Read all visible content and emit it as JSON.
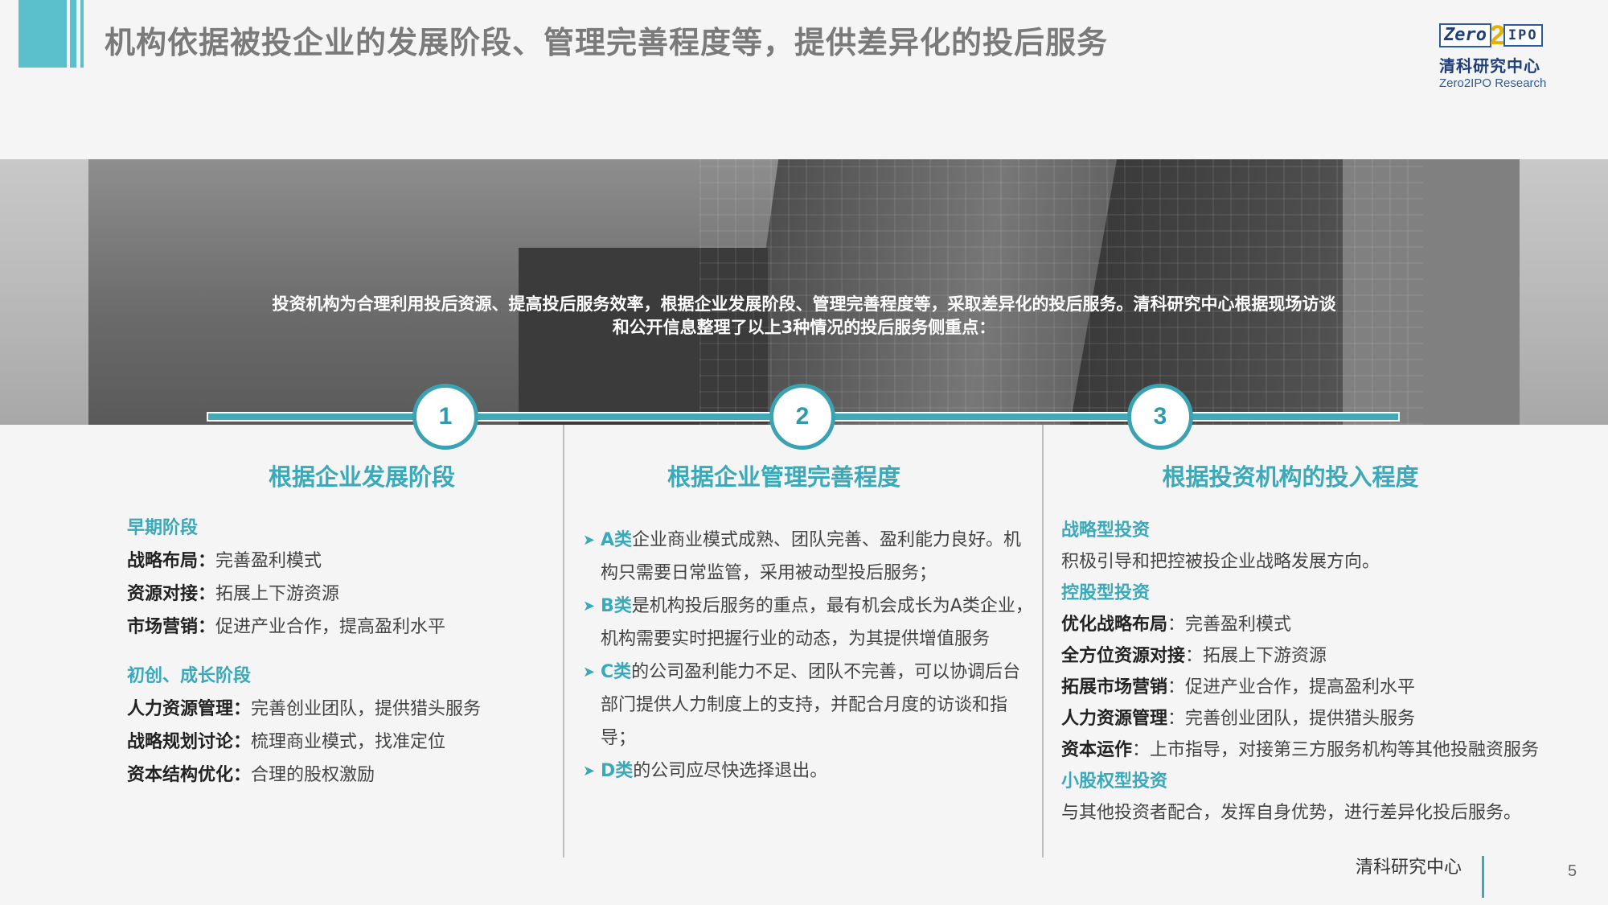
{
  "header": {
    "title": "机构依据被投企业的发展阶段、管理完善程度等，提供差异化的投后服务"
  },
  "logo": {
    "zero": "Zero",
    "two": "2",
    "ipo": "IPO",
    "cn": "清科研究中心",
    "en": "Zero2IPO Research"
  },
  "banner": {
    "line1": "投资机构为合理利用投后资源、提高投后服务效率，根据企业发展阶段、管理完善程度等，采取差异化的投后服务。清科研究中心根据现场访谈",
    "line2": "和公开信息整理了以上3种情况的投后服务侧重点："
  },
  "steps": [
    "1",
    "2",
    "3"
  ],
  "col1": {
    "title": "根据企业发展阶段",
    "sec1": {
      "heading": "早期阶段",
      "items": [
        {
          "k": "战略布局：",
          "v": "完善盈利模式"
        },
        {
          "k": "资源对接：",
          "v": "拓展上下游资源"
        },
        {
          "k": "市场营销：",
          "v": "促进产业合作，提高盈利水平"
        }
      ]
    },
    "sec2": {
      "heading": "初创、成长阶段",
      "items": [
        {
          "k": "人力资源管理：",
          "v": "完善创业团队，提供猎头服务"
        },
        {
          "k": "战略规划讨论：",
          "v": "梳理商业模式，找准定位"
        },
        {
          "k": "资本结构优化：",
          "v": "合理的股权激励"
        }
      ]
    }
  },
  "col2": {
    "title": "根据企业管理完善程度",
    "arrow": "➤",
    "items": [
      {
        "cls": "A类",
        "text": "企业商业模式成熟、团队完善、盈利能力良好。机构只需要日常监管，采用被动型投后服务；"
      },
      {
        "cls": "B类",
        "text": "是机构投后服务的重点，最有机会成长为A类企业，机构需要实时把握行业的动态，为其提供增值服务"
      },
      {
        "cls": "C类",
        "text": "的公司盈利能力不足、团队不完善，可以协调后台部门提供人力制度上的支持，并配合月度的访谈和指导；"
      },
      {
        "cls": "D类",
        "text": "的公司应尽快选择退出。"
      }
    ]
  },
  "col3": {
    "title": "根据投资机构的投入程度",
    "sec1": {
      "heading": "战略型投资",
      "desc": "积极引导和把控被投企业战略发展方向。"
    },
    "sec2": {
      "heading": "控股型投资",
      "items": [
        {
          "k": "优化战略布局",
          "v": "：完善盈利模式"
        },
        {
          "k": "全方位资源对接",
          "v": "：拓展上下游资源"
        },
        {
          "k": "拓展市场营销",
          "v": "：促进产业合作，提高盈利水平"
        },
        {
          "k": "人力资源管理",
          "v": "：完善创业团队，提供猎头服务"
        },
        {
          "k": "资本运作",
          "v": "：上市指导，对接第三方服务机构等其他投融资服务"
        }
      ]
    },
    "sec3": {
      "heading": "小股权型投资",
      "desc": "与其他投资者配合，发挥自身优势，进行差异化投后服务。"
    }
  },
  "footer": {
    "org": "清科研究中心",
    "page": "5"
  },
  "colors": {
    "accent": "#3aa9b9",
    "header_bar": "#5bc0cc",
    "title_gray": "#7a7a7a"
  }
}
